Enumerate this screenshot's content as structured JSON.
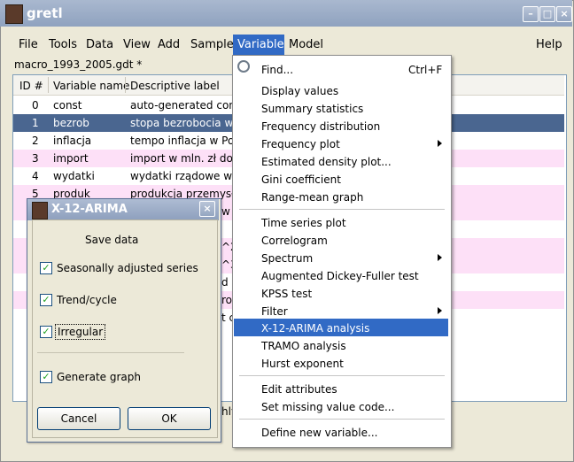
{
  "window": {
    "title": "gretl",
    "filename": "macro_1993_2005.gdt *"
  },
  "menubar": [
    "File",
    "Tools",
    "Data",
    "View",
    "Add",
    "Sample",
    "Variable",
    "Model",
    "Help"
  ],
  "table": {
    "headers": [
      "ID #",
      "Variable name",
      "Descriptive label"
    ],
    "rows": [
      {
        "id": "0",
        "name": "const",
        "label": "auto-generated const"
      },
      {
        "id": "1",
        "name": "bezrob",
        "label": "stopa bezrobocia w Po"
      },
      {
        "id": "2",
        "name": "inflacja",
        "label": "tempo inflacja w Polsc"
      },
      {
        "id": "3",
        "name": "import",
        "label": "import w mln. zł do Po"
      },
      {
        "id": "4",
        "name": "wydatki",
        "label": "wydatki rządowe w m"
      },
      {
        "id": "5",
        "name": "produk",
        "label": "produkcja przemysłow"
      }
    ],
    "fragments": [
      "w m",
      "^2",
      "^3",
      "d b",
      "rob",
      "t c",
      "hly"
    ]
  },
  "dialog": {
    "title": "X-12-ARIMA",
    "heading": "Save data",
    "options": [
      {
        "label": "Seasonally adjusted series",
        "checked": true
      },
      {
        "label": "Trend/cycle",
        "checked": true
      },
      {
        "label": "Irregular",
        "checked": true
      },
      {
        "label": "Generate graph",
        "checked": true
      }
    ],
    "cancel": "Cancel",
    "ok": "OK"
  },
  "popup": {
    "items": [
      {
        "label": "Find...",
        "shortcut": "Ctrl+F"
      },
      {
        "label": "Display values"
      },
      {
        "label": "Summary statistics"
      },
      {
        "label": "Frequency distribution"
      },
      {
        "label": "Frequency plot"
      },
      {
        "label": "Estimated density plot..."
      },
      {
        "label": "Gini coefficient"
      },
      {
        "label": "Range-mean graph"
      },
      {
        "label": "Time series plot"
      },
      {
        "label": "Correlogram"
      },
      {
        "label": "Spectrum"
      },
      {
        "label": "Augmented Dickey-Fuller test"
      },
      {
        "label": "KPSS test"
      },
      {
        "label": "Filter"
      },
      {
        "label": "X-12-ARIMA analysis"
      },
      {
        "label": "TRAMO analysis"
      },
      {
        "label": "Hurst exponent"
      },
      {
        "label": "Edit attributes"
      },
      {
        "label": "Set missing value code..."
      },
      {
        "label": "Define new variable..."
      }
    ]
  },
  "colors": {
    "selection": "#316ac5",
    "row_alt": "#fde0f7",
    "title_bar": "#9aabc6"
  }
}
